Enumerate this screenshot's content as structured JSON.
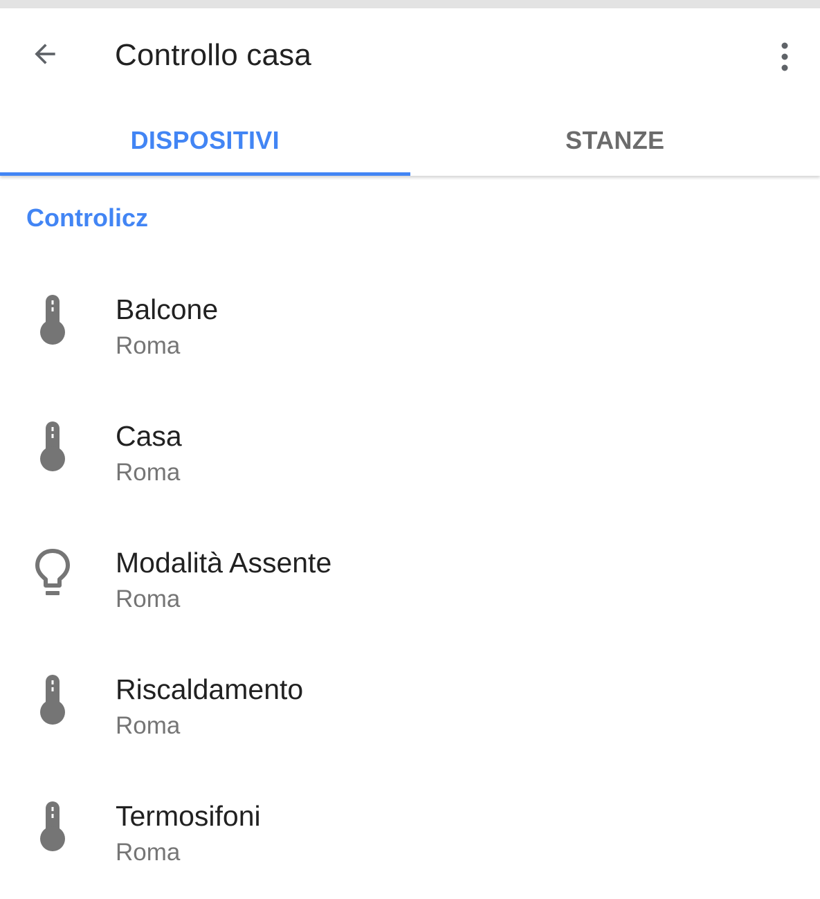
{
  "header": {
    "title": "Controllo casa",
    "back_icon": "arrow-back-icon",
    "more_icon": "more-vert-icon"
  },
  "tabs": [
    {
      "label": "DISPOSITIVI",
      "active": true
    },
    {
      "label": "STANZE",
      "active": false
    }
  ],
  "section": {
    "title": "Controlicz"
  },
  "devices": [
    {
      "name": "Balcone",
      "location": "Roma",
      "icon": "thermometer-icon"
    },
    {
      "name": "Casa",
      "location": "Roma",
      "icon": "thermometer-icon"
    },
    {
      "name": "Modalità Assente",
      "location": "Roma",
      "icon": "lightbulb-icon"
    },
    {
      "name": "Riscaldamento",
      "location": "Roma",
      "icon": "thermometer-icon"
    },
    {
      "name": "Termosifoni",
      "location": "Roma",
      "icon": "thermometer-icon"
    }
  ],
  "colors": {
    "accent": "#4285f4",
    "icon": "#757575",
    "primary_text": "#212121",
    "secondary_text": "#757575"
  }
}
